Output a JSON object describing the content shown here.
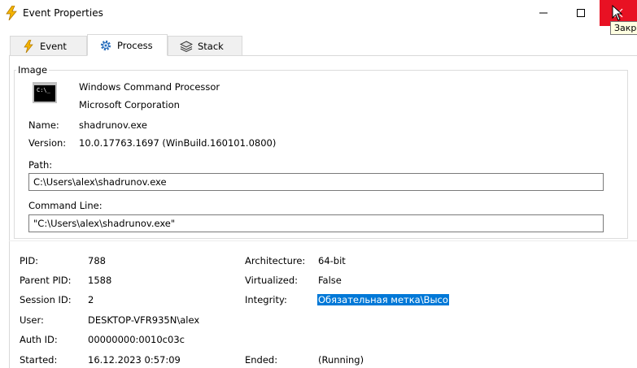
{
  "window": {
    "title": "Event Properties",
    "close_tooltip": "Закры"
  },
  "tabs": [
    {
      "label": "Event",
      "icon": "lightning-icon"
    },
    {
      "label": "Process",
      "icon": "gear-icon"
    },
    {
      "label": "Stack",
      "icon": "layers-icon"
    }
  ],
  "image": {
    "legend": "Image",
    "product": "Windows Command Processor",
    "company": "Microsoft Corporation",
    "name_label": "Name:",
    "name_value": "shadrunov.exe",
    "version_label": "Version:",
    "version_value": "10.0.17763.1697 (WinBuild.160101.0800)",
    "path_label": "Path:",
    "path_value": "C:\\Users\\alex\\shadrunov.exe",
    "cmdline_label": "Command Line:",
    "cmdline_value": "\"C:\\Users\\alex\\shadrunov.exe\""
  },
  "details": {
    "pid_label": "PID:",
    "pid_value": "788",
    "parent_pid_label": "Parent PID:",
    "parent_pid_value": "1588",
    "session_label": "Session ID:",
    "session_value": "2",
    "user_label": "User:",
    "user_value": "DESKTOP-VFR935N\\alex",
    "auth_label": "Auth ID:",
    "auth_value": "00000000:0010c03c",
    "started_label": "Started:",
    "started_value": "16.12.2023 0:57:09",
    "arch_label": "Architecture:",
    "arch_value": "64-bit",
    "virt_label": "Virtualized:",
    "virt_value": "False",
    "integrity_label": "Integrity:",
    "integrity_value": "Обязательная метка\\Высо",
    "ended_label": "Ended:",
    "ended_value": "(Running)"
  }
}
